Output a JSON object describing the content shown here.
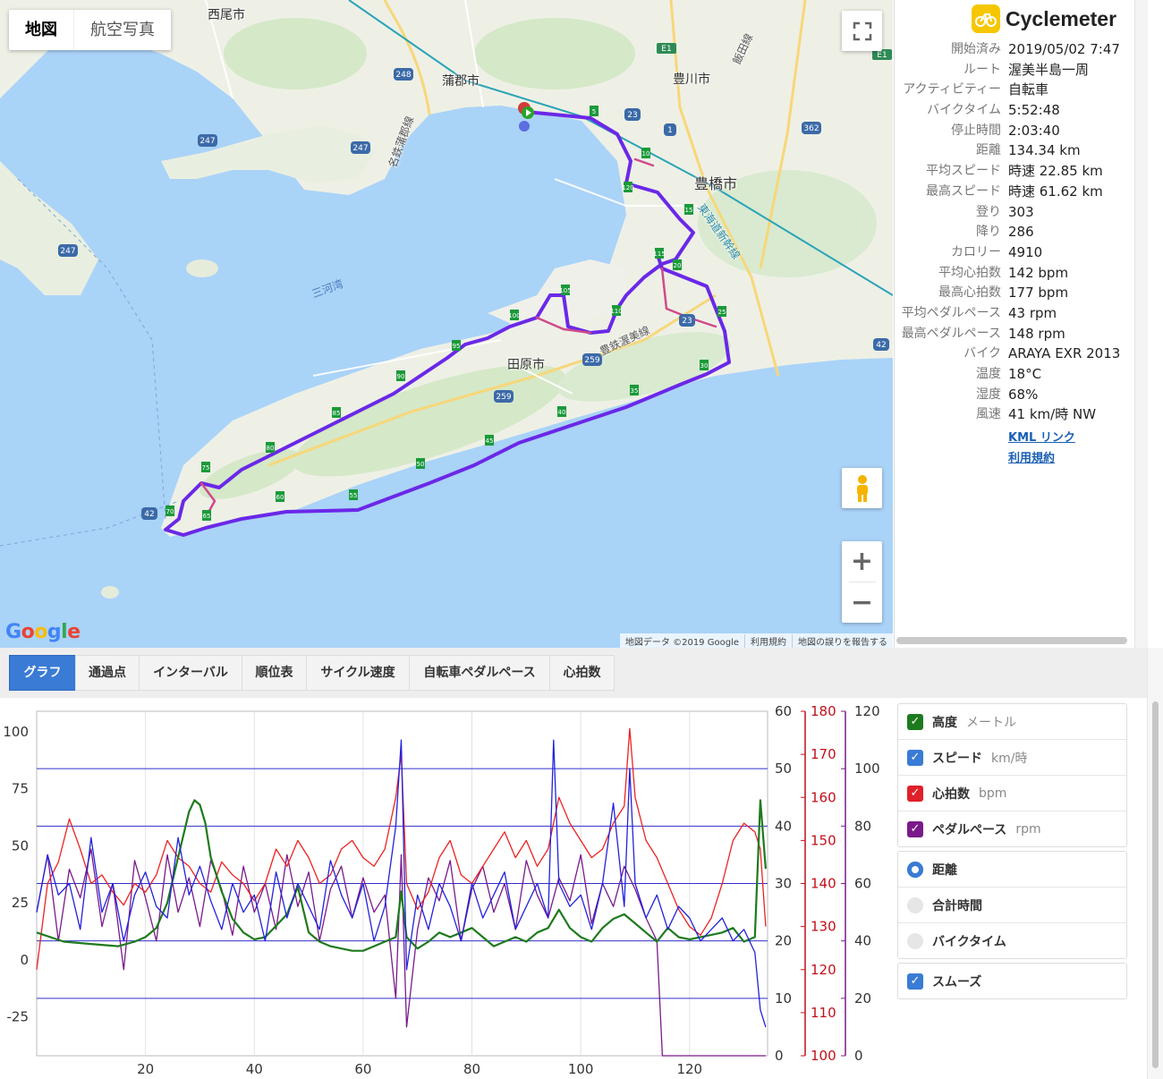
{
  "map": {
    "type_buttons": [
      "地図",
      "航空写真"
    ],
    "labels": {
      "nishio": "西尾市",
      "gamagori": "蒲郡市",
      "toyokawa": "豊川市",
      "toyohashi": "豊橋市",
      "tahara": "田原市",
      "mikawa_bay": "三河湾",
      "meitetsu": "名鉄蒲郡線",
      "iida": "飯田線",
      "toyotetsu": "豊鉄渥美線",
      "shinkansen": "東海道新幹線"
    },
    "footer": [
      "地図データ ©2019 Google",
      "利用規約",
      "地図の誤りを報告する"
    ],
    "logo": "Google",
    "zoom_in": "+",
    "zoom_out": "−",
    "km_markers": [
      "5",
      "10",
      "15",
      "20",
      "25",
      "30",
      "35",
      "40",
      "45",
      "50",
      "55",
      "60",
      "65",
      "70",
      "75",
      "80",
      "85",
      "90",
      "95",
      "100",
      "105",
      "110",
      "115",
      "120"
    ]
  },
  "panel": {
    "brand": "Cyclemeter",
    "stats": [
      {
        "k": "開始済み",
        "v": "2019/05/02 7:47"
      },
      {
        "k": "ルート",
        "v": "渥美半島一周"
      },
      {
        "k": "アクティビティー",
        "v": "自転車"
      },
      {
        "k": "バイクタイム",
        "v": "5:52:48"
      },
      {
        "k": "停止時間",
        "v": "2:03:40"
      },
      {
        "k": "距離",
        "v": "134.34 km"
      },
      {
        "k": "平均スピード",
        "v": "時速 22.85 km"
      },
      {
        "k": "最高スピード",
        "v": "時速 61.62 km"
      },
      {
        "k": "登り",
        "v": "303"
      },
      {
        "k": "降り",
        "v": "286"
      },
      {
        "k": "カロリー",
        "v": "4910"
      },
      {
        "k": "平均心拍数",
        "v": "142 bpm"
      },
      {
        "k": "最高心拍数",
        "v": "177 bpm"
      },
      {
        "k": "平均ペダルペース",
        "v": "43 rpm"
      },
      {
        "k": "最高ペダルペース",
        "v": "148 rpm"
      },
      {
        "k": "バイク",
        "v": "ARAYA EXR 2013"
      },
      {
        "k": "温度",
        "v": "18°C"
      },
      {
        "k": "湿度",
        "v": "68%"
      },
      {
        "k": "風速",
        "v": "41 km/時 NW"
      }
    ],
    "kml_link": "KML リンク",
    "terms_link": "利用規約"
  },
  "tabs": [
    "グラフ",
    "通過点",
    "インターバル",
    "順位表",
    "サイクル速度",
    "自転車ペダルペース",
    "心拍数"
  ],
  "legend": {
    "series": [
      {
        "label": "高度",
        "unit": "メートル",
        "color": "#1e7a1e",
        "checked": true
      },
      {
        "label": "スピード",
        "unit": "km/時",
        "color": "#3a7bd5",
        "checked": true
      },
      {
        "label": "心拍数",
        "unit": "bpm",
        "color": "#e0202a",
        "checked": true
      },
      {
        "label": "ペダルペース",
        "unit": "rpm",
        "color": "#7a1a8a",
        "checked": true
      }
    ],
    "xaxis_options": [
      {
        "label": "距離",
        "selected": true
      },
      {
        "label": "合計時間",
        "selected": false
      },
      {
        "label": "バイクタイム",
        "selected": false
      }
    ],
    "smooth": {
      "label": "スムーズ",
      "checked": true
    }
  },
  "chart_data": {
    "type": "line",
    "x_label": "",
    "x_ticks": [
      20,
      40,
      60,
      80,
      100,
      120
    ],
    "xlim": [
      0,
      134.34
    ],
    "axes": [
      {
        "series": "高度",
        "ticks": [
          100,
          75,
          50,
          25,
          0,
          -25
        ],
        "range": [
          -42,
          109
        ],
        "color": "#333"
      },
      {
        "series": "スピード",
        "ticks": [
          60,
          50,
          40,
          30,
          20,
          10,
          0
        ],
        "range": [
          0,
          60
        ],
        "color": "#333"
      },
      {
        "series": "心拍数",
        "ticks": [
          180,
          170,
          160,
          150,
          140,
          130,
          120,
          110,
          100
        ],
        "range": [
          100,
          180
        ],
        "color": "#c0101a"
      },
      {
        "series": "ペダルペース",
        "ticks": [
          120,
          100,
          80,
          60,
          40,
          20,
          0
        ],
        "range": [
          0,
          120
        ],
        "color": "#7a1a8a"
      }
    ],
    "series": [
      {
        "name": "高度",
        "color": "#1e7a1e",
        "x": [
          0,
          5,
          10,
          15,
          18,
          20,
          22,
          24,
          26,
          28,
          29,
          30,
          31,
          32,
          34,
          36,
          38,
          40,
          42,
          44,
          46,
          48,
          50,
          52,
          54,
          56,
          58,
          60,
          62,
          64,
          66,
          67,
          68,
          70,
          72,
          74,
          76,
          78,
          80,
          82,
          84,
          86,
          88,
          90,
          92,
          94,
          96,
          98,
          100,
          102,
          104,
          106,
          108,
          110,
          112,
          114,
          116,
          118,
          120,
          122,
          124,
          126,
          128,
          130,
          132,
          133,
          134
        ],
        "y": [
          12,
          8,
          7,
          6,
          8,
          10,
          14,
          25,
          45,
          65,
          70,
          68,
          60,
          45,
          30,
          18,
          12,
          9,
          10,
          15,
          20,
          32,
          12,
          8,
          6,
          5,
          4,
          4,
          6,
          8,
          10,
          30,
          10,
          5,
          8,
          12,
          10,
          12,
          14,
          10,
          6,
          8,
          10,
          8,
          12,
          14,
          22,
          14,
          10,
          8,
          14,
          18,
          20,
          16,
          12,
          8,
          14,
          10,
          9,
          10,
          11,
          12,
          14,
          8,
          10,
          70,
          40
        ]
      },
      {
        "name": "スピード",
        "color": "#2222dd",
        "x": [
          0,
          2,
          4,
          6,
          8,
          10,
          12,
          14,
          16,
          18,
          20,
          22,
          24,
          26,
          28,
          30,
          32,
          34,
          36,
          38,
          40,
          42,
          44,
          46,
          48,
          50,
          52,
          54,
          56,
          58,
          60,
          62,
          64,
          66,
          67,
          68,
          70,
          72,
          74,
          76,
          78,
          80,
          82,
          84,
          86,
          88,
          90,
          92,
          94,
          95,
          96,
          98,
          100,
          102,
          104,
          106,
          108,
          109,
          110,
          112,
          114,
          116,
          118,
          120,
          122,
          124,
          126,
          128,
          130,
          132,
          133,
          134
        ],
        "y": [
          25,
          35,
          28,
          30,
          22,
          38,
          25,
          30,
          20,
          28,
          32,
          26,
          24,
          38,
          28,
          33,
          27,
          22,
          30,
          25,
          28,
          20,
          32,
          24,
          30,
          26,
          22,
          34,
          28,
          24,
          30,
          20,
          26,
          40,
          55,
          15,
          28,
          22,
          30,
          26,
          20,
          30,
          24,
          28,
          32,
          22,
          26,
          30,
          24,
          55,
          30,
          26,
          28,
          22,
          30,
          44,
          26,
          50,
          30,
          24,
          28,
          22,
          26,
          24,
          20,
          22,
          24,
          20,
          22,
          18,
          8,
          5
        ]
      },
      {
        "name": "心拍数",
        "color": "#ee2222",
        "x": [
          0,
          2,
          4,
          6,
          8,
          10,
          12,
          14,
          16,
          18,
          20,
          22,
          24,
          26,
          28,
          30,
          32,
          34,
          36,
          38,
          40,
          42,
          44,
          46,
          48,
          50,
          52,
          54,
          56,
          58,
          60,
          62,
          64,
          66,
          67,
          68,
          70,
          72,
          74,
          76,
          78,
          80,
          82,
          84,
          86,
          88,
          90,
          92,
          94,
          96,
          98,
          100,
          102,
          104,
          106,
          108,
          109,
          110,
          112,
          114,
          116,
          118,
          120,
          122,
          124,
          126,
          128,
          130,
          132,
          133,
          134
        ],
        "y": [
          120,
          140,
          145,
          155,
          148,
          140,
          142,
          138,
          135,
          140,
          138,
          142,
          150,
          146,
          144,
          140,
          138,
          145,
          142,
          140,
          136,
          140,
          148,
          144,
          150,
          146,
          140,
          142,
          148,
          150,
          146,
          144,
          148,
          160,
          170,
          140,
          134,
          138,
          146,
          150,
          142,
          140,
          144,
          148,
          152,
          146,
          150,
          144,
          148,
          160,
          154,
          150,
          146,
          148,
          154,
          158,
          176,
          160,
          150,
          146,
          140,
          134,
          130,
          128,
          132,
          140,
          150,
          154,
          152,
          148,
          130
        ]
      },
      {
        "name": "ペダルペース",
        "color": "#7a1a8a",
        "x": [
          0,
          2,
          4,
          6,
          8,
          10,
          12,
          14,
          16,
          18,
          20,
          22,
          24,
          26,
          28,
          30,
          32,
          34,
          36,
          38,
          40,
          42,
          44,
          46,
          48,
          50,
          52,
          54,
          56,
          58,
          60,
          62,
          64,
          66,
          67,
          68,
          70,
          72,
          74,
          76,
          78,
          80,
          82,
          84,
          86,
          88,
          90,
          92,
          94,
          96,
          98,
          100,
          102,
          104,
          106,
          108,
          110,
          112,
          114,
          115,
          116,
          118,
          120,
          122,
          124,
          126,
          128,
          130,
          132,
          134
        ],
        "y": [
          50,
          70,
          40,
          65,
          55,
          72,
          45,
          60,
          30,
          68,
          55,
          40,
          70,
          50,
          62,
          45,
          68,
          58,
          42,
          66,
          50,
          60,
          44,
          70,
          52,
          64,
          40,
          58,
          66,
          48,
          62,
          50,
          56,
          20,
          70,
          10,
          44,
          62,
          54,
          68,
          40,
          58,
          66,
          50,
          60,
          44,
          68,
          56,
          48,
          62,
          54,
          70,
          46,
          60,
          52,
          66,
          58,
          48,
          40,
          0,
          0,
          0,
          0,
          0,
          0,
          0,
          0,
          0,
          0,
          0
        ]
      }
    ]
  }
}
